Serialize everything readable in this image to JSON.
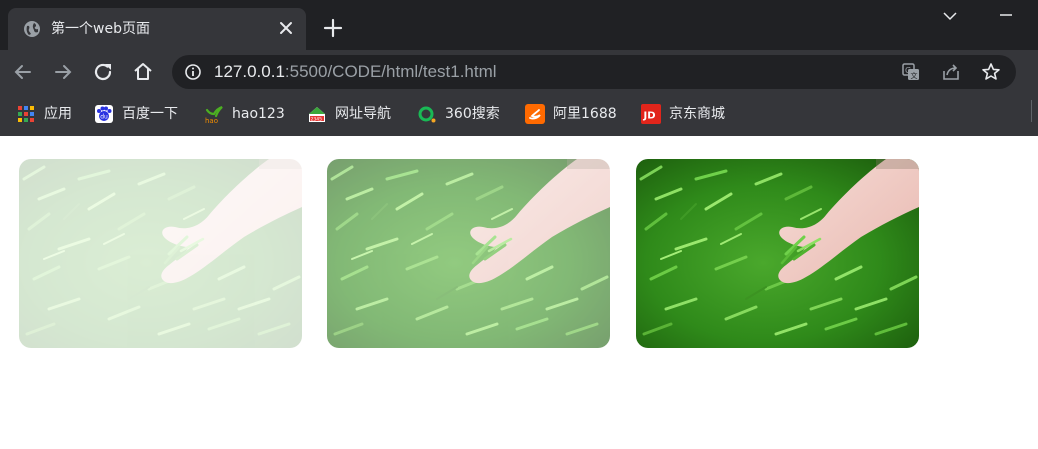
{
  "tab": {
    "title": "第一个web页面",
    "icon": "globe-icon",
    "close_icon": "close-icon",
    "new_tab_icon": "plus-icon"
  },
  "window": {
    "dropdown_icon": "chevron-down-icon",
    "minimize_icon": "minimize-icon"
  },
  "toolbar": {
    "back_icon": "arrow-left-icon",
    "forward_icon": "arrow-right-icon",
    "reload_icon": "reload-icon",
    "home_icon": "home-icon",
    "url_host": "127.0.0.1",
    "url_rest": ":5500/CODE/html/test1.html",
    "translate_icon": "translate-icon",
    "share_icon": "share-icon",
    "star_icon": "star-icon"
  },
  "bookmarks": [
    {
      "label": "应用",
      "icon": "apps-grid-icon"
    },
    {
      "label": "百度一下",
      "icon": "baidu-icon"
    },
    {
      "label": "hao123",
      "icon": "hao123-icon"
    },
    {
      "label": "网址导航",
      "icon": "2345-icon"
    },
    {
      "label": "360搜索",
      "icon": "360-search-icon"
    },
    {
      "label": "阿里1688",
      "icon": "alibaba-1688-icon"
    },
    {
      "label": "京东商城",
      "icon": "jd-icon"
    }
  ],
  "images": [
    {
      "name": "tea-leaves-photo-faded",
      "opacity": 0.2
    },
    {
      "name": "tea-leaves-photo-semi",
      "opacity": 0.6
    },
    {
      "name": "tea-leaves-photo-full",
      "opacity": 1.0
    }
  ],
  "colors": {
    "tabstrip_bg": "#202124",
    "toolbar_bg": "#35363a",
    "omnibox_bg": "#202124",
    "text": "#e8eaed",
    "text_muted": "#9aa0a6",
    "grass_dark": "#1f5e0d",
    "grass_light": "#6cc24a"
  }
}
